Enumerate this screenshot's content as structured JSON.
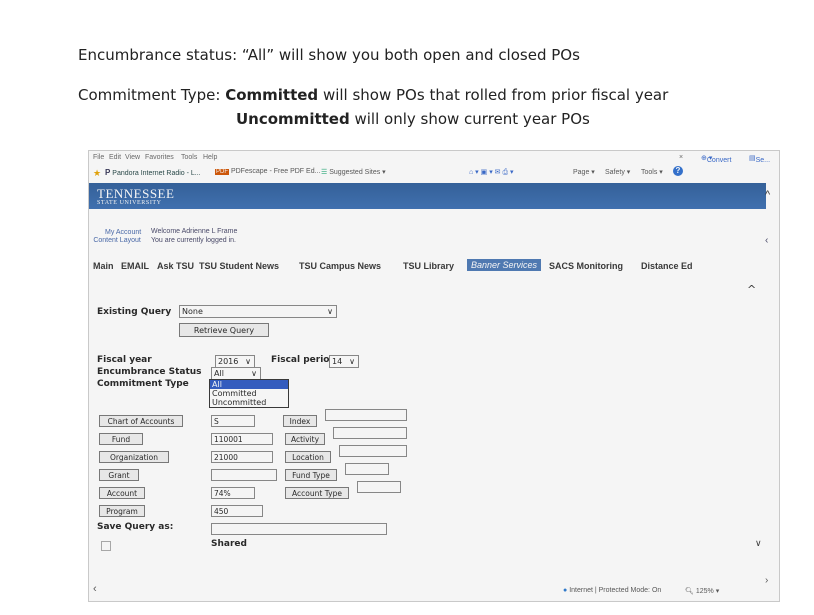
{
  "notes": {
    "line1": "Encumbrance status: “All” will show you both open and closed POs",
    "line2_prefix": "Commitment Type: ",
    "line2_bold": "Committed",
    "line2_rest": " will show POs that rolled from prior fiscal year",
    "line3_bold": "Uncommitted",
    "line3_rest": " will only show current year POs"
  },
  "browser": {
    "menu": [
      "File",
      "Edit",
      "View",
      "Favorites",
      "Tools",
      "Help"
    ],
    "favorites": [
      "Pandora Internet Radio - L...",
      "PDFescape - Free PDF Ed...",
      "Suggested Sites ▾"
    ],
    "toolbar_right": [
      "Convert",
      "Se..."
    ],
    "toolbar_tools": [
      "Page ▾",
      "Safety ▾",
      "Tools ▾"
    ],
    "status_text": "Internet | Protected Mode: On",
    "zoom": "125%"
  },
  "portal": {
    "logo_line1": "TENNESSEE",
    "logo_line2": "STATE UNIVERSITY",
    "my_account": "My Account",
    "content_layout": "Content Layout",
    "welcome": "Welcome Adrienne L Frame",
    "logged_in": "You are currently logged in.",
    "tabs": [
      "Main",
      "EMAIL",
      "Ask TSU",
      "TSU Student News",
      "TSU Campus News",
      "TSU Library",
      "Banner Services",
      "SACS Monitoring",
      "Distance Ed"
    ],
    "active_tab": "Banner Services"
  },
  "form": {
    "existing_query_label": "Existing Query",
    "existing_query_value": "None",
    "retrieve_button": "Retrieve Query",
    "fiscal_year_label": "Fiscal year",
    "fiscal_year_value": "2016",
    "fiscal_period_label": "Fiscal period",
    "fiscal_period_value": "14",
    "encumbrance_label": "Encumbrance Status",
    "encumbrance_value": "All",
    "commitment_label": "Commitment Type",
    "commitment_options": [
      "All",
      "Committed",
      "Uncommitted"
    ],
    "commitment_selected": "All",
    "chart_button": "Chart of Accounts",
    "chart_value": "S",
    "index_button": "Index",
    "index_value": "",
    "fund_button": "Fund",
    "fund_value": "110001",
    "activity_button": "Activity",
    "activity_value": "",
    "org_button": "Organization",
    "org_value": "21000",
    "location_button": "Location",
    "location_value": "",
    "grant_button": "Grant",
    "grant_value": "",
    "fund_type_button": "Fund Type",
    "fund_type_value": "",
    "account_button": "Account",
    "account_value": "74%",
    "account_type_button": "Account Type",
    "account_type_value": "",
    "program_button": "Program",
    "program_value": "450",
    "save_query_label": "Save Query as:",
    "save_query_value": "",
    "shared_label": "Shared"
  }
}
